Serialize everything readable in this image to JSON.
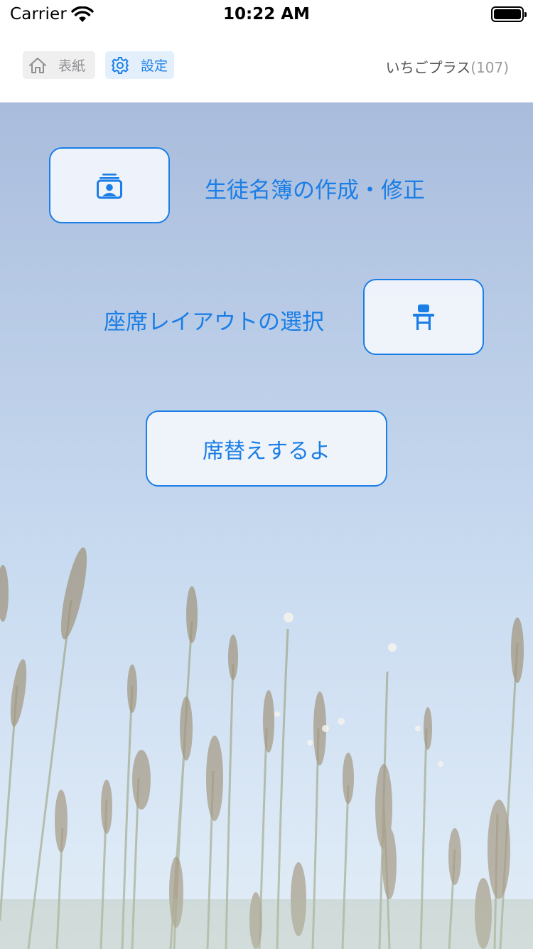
{
  "status_bar": {
    "carrier": "Carrier",
    "time": "10:22 AM"
  },
  "nav": {
    "tabs": [
      {
        "label": "表紙",
        "icon": "home-icon",
        "selected": false
      },
      {
        "label": "設定",
        "icon": "gear-icon",
        "selected": true
      }
    ],
    "app_name": "いちごプラス",
    "app_count": "(107)"
  },
  "main": {
    "roster_label": "生徒名簿の作成・修正",
    "roster_icon": "contact-card-icon",
    "seat_label": "座席レイアウトの選択",
    "seat_icon": "desk-chair-icon",
    "shuffle_label": "席替えするよ"
  },
  "colors": {
    "accent": "#1a7ee6",
    "sky_top": "#a9bcdc",
    "sky_bottom": "#d2e4f5"
  }
}
